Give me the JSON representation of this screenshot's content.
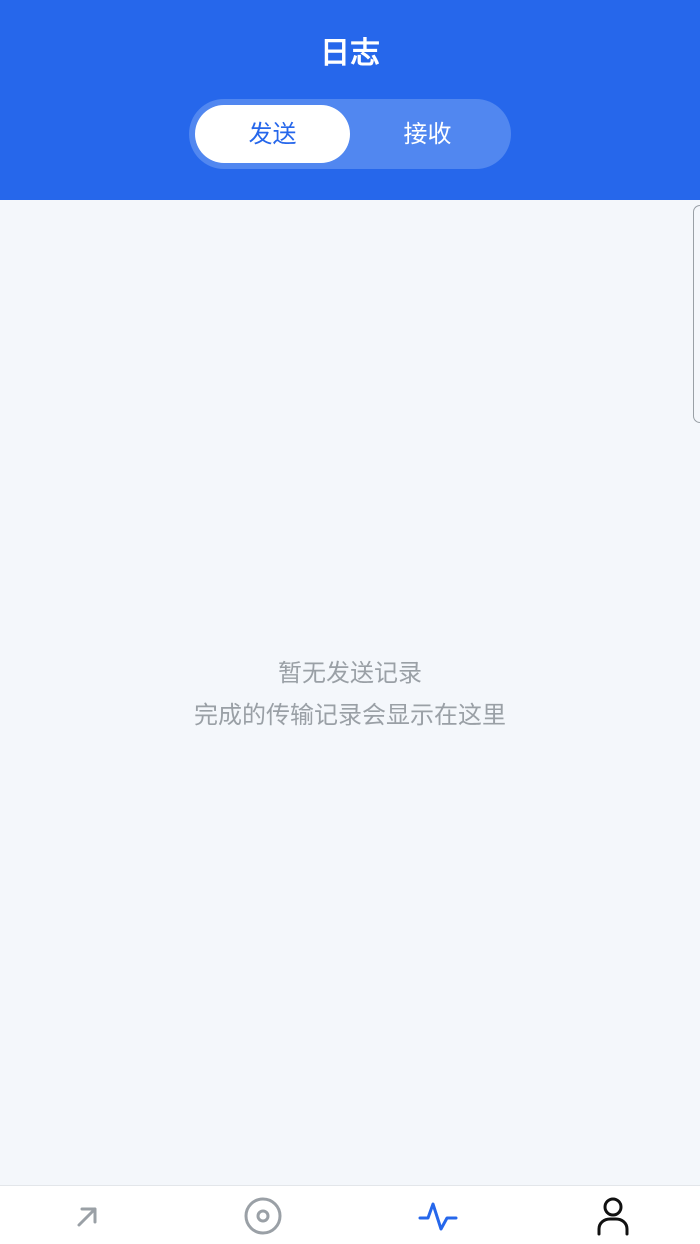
{
  "header": {
    "title": "日志",
    "segments": [
      {
        "label": "发送",
        "active": true
      },
      {
        "label": "接收",
        "active": false
      }
    ]
  },
  "empty_state": {
    "title": "暂无发送记录",
    "subtitle": "完成的传输记录会显示在这里"
  },
  "tabbar": {
    "items": [
      {
        "icon": "arrow-up-right-icon",
        "active": false
      },
      {
        "icon": "target-circle-icon",
        "active": false
      },
      {
        "icon": "activity-pulse-icon",
        "active": true
      },
      {
        "icon": "user-icon",
        "active": false
      }
    ]
  },
  "colors": {
    "primary": "#2667EB",
    "segment_track": "#5187F0",
    "background": "#F4F7FB",
    "muted_text": "#9AA0A6",
    "inactive_icon": "#9AA0A6",
    "dark_icon": "#111111"
  }
}
